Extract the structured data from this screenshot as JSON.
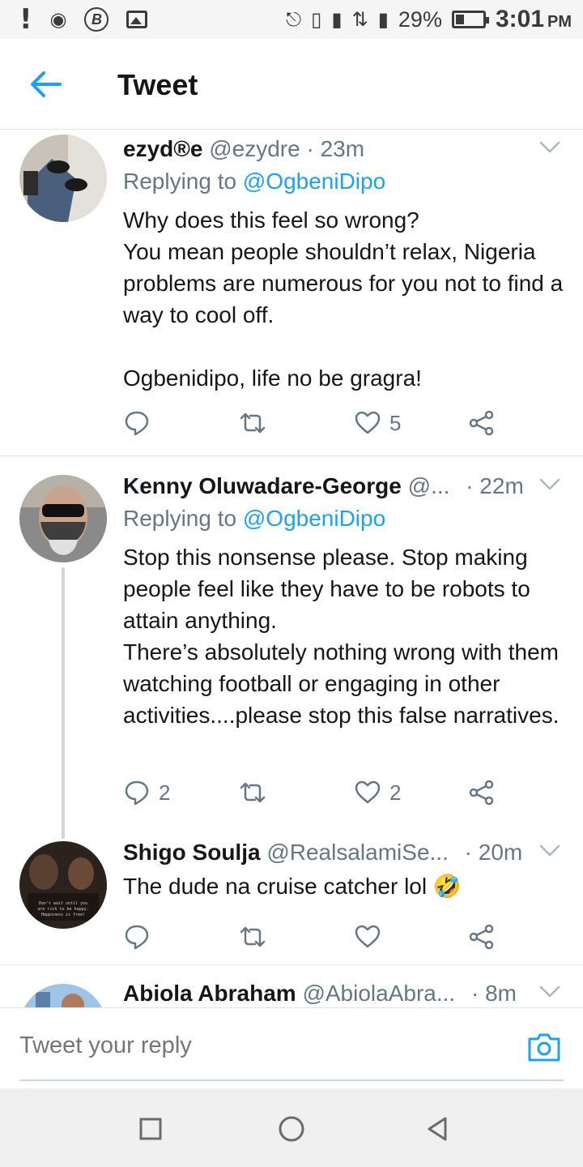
{
  "status_bar": {
    "battery": "29%",
    "time": "3:01",
    "ampm": "PM",
    "battery_level": 0.29,
    "icons": [
      "alert-icon",
      "headset-icon",
      "bitcoin-icon",
      "gallery-icon",
      "nfc-icon",
      "vibrate-icon",
      "signal-e-icon",
      "data-arrows-icon",
      "signal-h-icon",
      "battery-icon"
    ]
  },
  "header": {
    "title": "Tweet",
    "back_icon": "back-arrow-icon"
  },
  "tweets": [
    {
      "name": "ezyd®e",
      "handle": "@ezydre",
      "time": "· 23m",
      "replying_prefix": "Replying to ",
      "replying_to": "@OgbeniDipo",
      "body": "Why does this feel so wrong?\nYou mean people shouldn’t relax, Nigeria problems are numerous for you not to find a way to cool off.\n\nOgbenidipo, life no be gragra!",
      "reply_count": "",
      "retweet_count": "",
      "like_count": "5"
    },
    {
      "name": "Kenny Oluwadare-George",
      "handle": "@...",
      "time": "· 22m",
      "replying_prefix": "Replying to ",
      "replying_to": "@OgbeniDipo",
      "body": "Stop this nonsense please. Stop making people feel like they have to be robots to attain anything.\nThere’s absolutely nothing wrong with them watching football or engaging in other activities....please stop this false narratives.",
      "reply_count": "2",
      "retweet_count": "",
      "like_count": "2"
    },
    {
      "name": "Shigo Soulja",
      "handle": "@RealsalamiSe...",
      "time": "· 20m",
      "body": "The dude na cruise catcher lol 🤣",
      "avatar_text": "Don't wait until you are rich to be happy. Happiness is free!",
      "reply_count": "",
      "retweet_count": "",
      "like_count": ""
    },
    {
      "name": "Abiola Abraham",
      "handle": "@AbiolaAbra...",
      "time": "· 8m"
    }
  ],
  "reply_bar": {
    "placeholder": "Tweet your reply"
  },
  "colors": {
    "accent": "#1da1f2",
    "secondary_text": "#657786",
    "primary_text": "#14171a",
    "divider": "#e1e8ed"
  }
}
